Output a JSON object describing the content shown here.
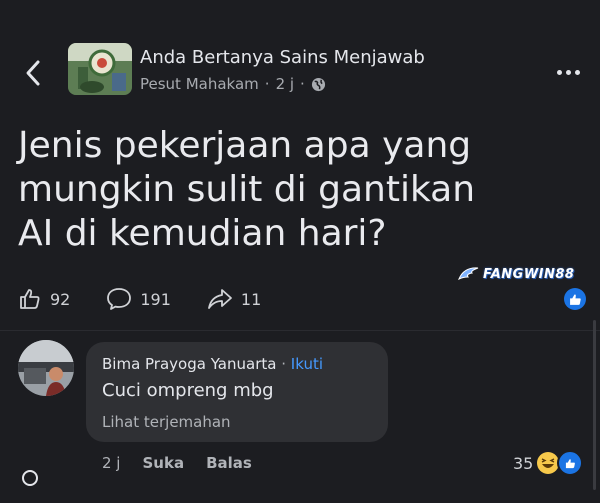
{
  "header": {
    "group_name": "Anda Bertanya Sains Menjawab",
    "author": "Pesut Mahakam",
    "time": "2 j",
    "separator": "·"
  },
  "post": {
    "text": "Jenis pekerjaan apa yang mungkin sulit di gantikan AI di kemudian hari?",
    "watermark": "FANGWIN88",
    "actions": {
      "likes": "92",
      "comments": "191",
      "shares": "11"
    }
  },
  "comment": {
    "author": "Bima Prayoga Yanuarta",
    "separator": "·",
    "follow_label": "Ikuti",
    "text": "Cuci ompreng mbg",
    "translate_label": "Lihat terjemahan",
    "time": "2 j",
    "like_label": "Suka",
    "reply_label": "Balas",
    "reaction_count": "35"
  },
  "colors": {
    "background": "#1c1d21",
    "bubble": "#2f3034",
    "accent_blue": "#1b74e4",
    "follow_blue": "#4599ff"
  },
  "icons": [
    "chevron-left-icon",
    "globe-icon",
    "more-icon",
    "like-icon",
    "comment-icon",
    "share-icon",
    "like-badge-icon",
    "haha-emoji-icon"
  ]
}
